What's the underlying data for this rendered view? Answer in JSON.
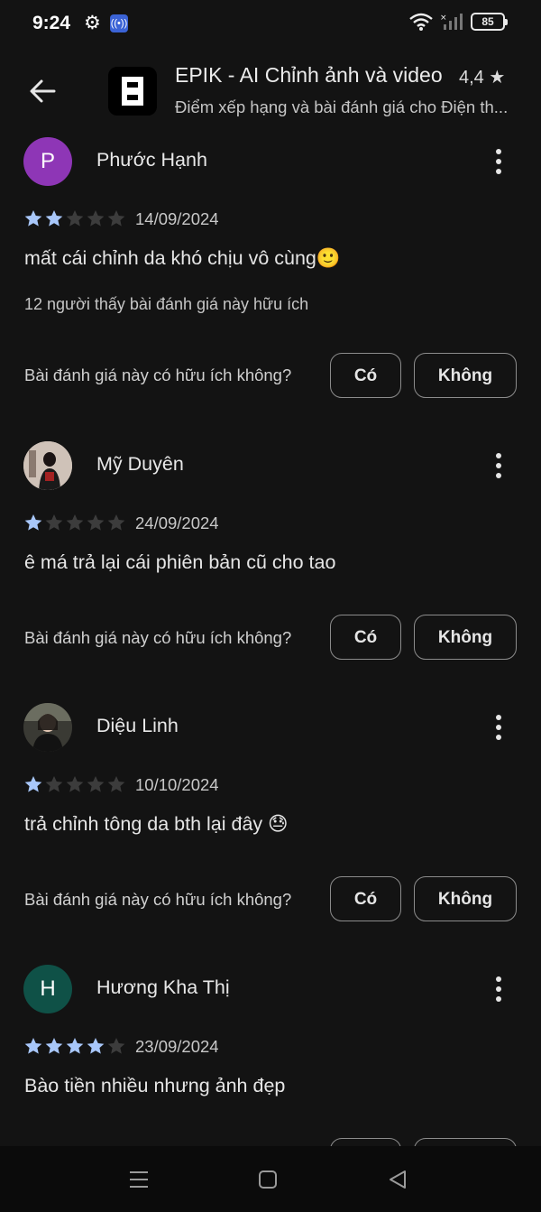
{
  "status_bar": {
    "time": "9:24",
    "battery": "85"
  },
  "app": {
    "title": "EPIK - AI Chỉnh ảnh và video",
    "rating": "4,4 ★",
    "subtitle": "Điểm xếp hạng và bài đánh giá cho Điện th..."
  },
  "colors": {
    "star_filled": "#a8c7fa",
    "star_empty": "#3c3c3c",
    "avatar_p": "#8e36b6",
    "avatar_h": "#0f5147"
  },
  "reviews": [
    {
      "avatar_initial": "P",
      "name": "Phước Hạnh",
      "stars": 2,
      "date": "14/09/2024",
      "text": "mất cái chỉnh da khó chịu vô cùng🙂",
      "helpful_count": "12 người thấy bài đánh giá này hữu ích",
      "question": "Bài đánh giá này có hữu ích không?",
      "yes": "Có",
      "no": "Không"
    },
    {
      "avatar_initial": "",
      "name": "Mỹ Duyên",
      "stars": 1,
      "date": "24/09/2024",
      "text": "ê má trả lại cái phiên bản cũ cho tao",
      "question": "Bài đánh giá này có hữu ích không?",
      "yes": "Có",
      "no": "Không"
    },
    {
      "avatar_initial": "",
      "name": "Diệu Linh",
      "stars": 1,
      "date": "10/10/2024",
      "text": "trả chỉnh tông da bth lại đây 😓",
      "question": "Bài đánh giá này có hữu ích không?",
      "yes": "Có",
      "no": "Không"
    },
    {
      "avatar_initial": "H",
      "name": "Hương Kha Thị",
      "stars": 4,
      "date": "23/09/2024",
      "text": "Bào tiền nhiều nhưng ảnh đẹp"
    }
  ]
}
